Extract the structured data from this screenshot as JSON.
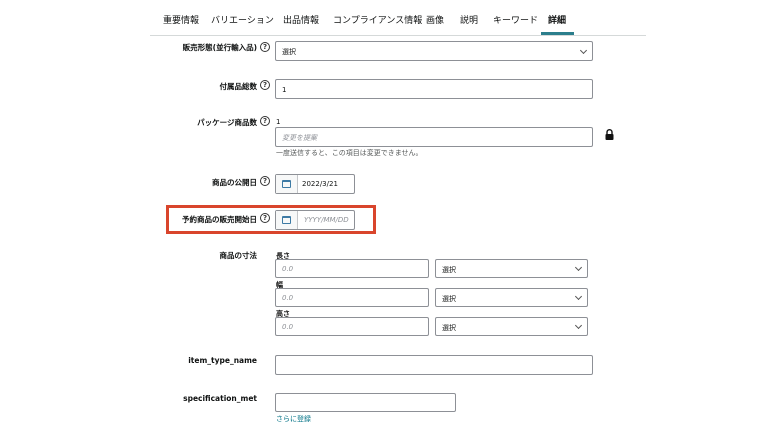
{
  "tabs": [
    {
      "label": "重要情報"
    },
    {
      "label": "バリエーション"
    },
    {
      "label": "出品情報"
    },
    {
      "label": "コンプライアンス情報"
    },
    {
      "label": "画像"
    },
    {
      "label": "説明"
    },
    {
      "label": "キーワード"
    },
    {
      "label": "詳細"
    }
  ],
  "active_tab": "詳細",
  "fields": {
    "sales_type": {
      "label": "販売形態(並行輸入品)",
      "value": "選択"
    },
    "accessory_count": {
      "label": "付属品総数",
      "value": "1"
    },
    "package_quantity": {
      "label": "パッケージ商品数",
      "current_value": "1",
      "placeholder": "変更を提案",
      "note": "一度送信すると、この項目は変更できません。"
    },
    "release_date": {
      "label": "商品の公開日",
      "value": "2022/3/21"
    },
    "preorder_date": {
      "label": "予約商品の販売開始日",
      "placeholder": "YYYY/MM/DD"
    },
    "dimensions": {
      "label": "商品の寸法",
      "length": {
        "label": "長さ",
        "placeholder": "0.0",
        "unit": "選択"
      },
      "width": {
        "label": "幅",
        "placeholder": "0.0",
        "unit": "選択"
      },
      "height": {
        "label": "高さ",
        "placeholder": "0.0",
        "unit": "選択"
      }
    },
    "item_type_name": {
      "label": "item_type_name",
      "value": ""
    },
    "specification_met": {
      "label": "specification_met",
      "value": "",
      "add_more": "さらに登録"
    }
  },
  "icons": {
    "help": "?",
    "calendar": "calendar-icon",
    "lock": "lock-icon",
    "chevron": "chevron-down-icon"
  },
  "colors": {
    "accent": "#2b7e8c",
    "highlight": "#d9452c",
    "link": "#007185",
    "calendar": "#3d7aa4"
  }
}
